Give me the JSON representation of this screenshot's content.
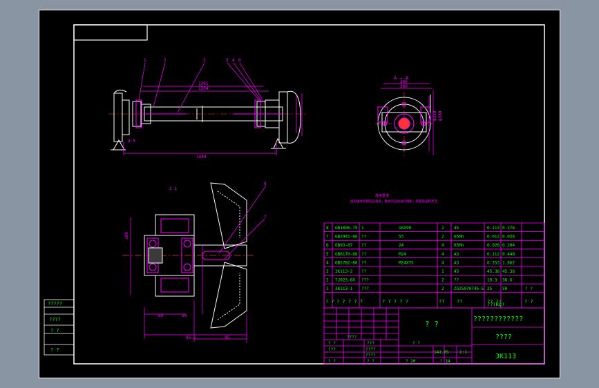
{
  "colors": {
    "frame": "#ffffff",
    "outline": "#ffffff",
    "dim": "#ff00ff",
    "leader": "#ff00ff",
    "text": "#00ff00",
    "section": "#ff00ff",
    "axis": "#ff3333",
    "table_line": "#ff00ff",
    "table_text": "#00ff00"
  },
  "top_view": {
    "balloons": [
      "1",
      "2",
      "3",
      "5",
      "4",
      "6"
    ],
    "dims": {
      "overall": "1440",
      "inner1": "1391",
      "inner2": "1304",
      "left_small": "4.5"
    }
  },
  "section_view": {
    "title": "A — A",
    "dims": {
      "top1": "340",
      "top2": "280",
      "right1": "φ350",
      "right2": "φ380"
    }
  },
  "detail_view": {
    "balloons": [
      "8",
      "7"
    ],
    "top_marks": "3   1",
    "dims": {
      "left": "100",
      "b1": "60",
      "b2": "50",
      "b3": "85.5",
      "b4": "95"
    }
  },
  "note_title": "技术要求",
  "note_text": "齿轮轴承装配前应清洗，轴承内应加注润滑脂，装配后运转灵活",
  "parts": [
    {
      "no": "8",
      "code": "GB1096-79",
      "name": "1",
      "spec": "16X90",
      "qty": "2",
      "mat": "45",
      "w1": "0.113",
      "w2": "0.276",
      "remark": ""
    },
    {
      "no": "7",
      "code": "GB2941-86",
      "name": "??",
      "spec": "55",
      "qty": "2",
      "mat": "65Mn",
      "w1": "0.012",
      "w2": "0.026",
      "remark": ""
    },
    {
      "no": "6",
      "code": "GB93-87",
      "name": "??",
      "spec": "24",
      "qty": "4",
      "mat": "65Mn",
      "w1": "0.026",
      "w2": "0.104",
      "remark": ""
    },
    {
      "no": "5",
      "code": "GB6170-86",
      "name": "??",
      "spec": "M24",
      "qty": "4",
      "mat": "A3",
      "w1": "0.112",
      "w2": "0.448",
      "remark": ""
    },
    {
      "no": "4",
      "code": "GB5782-86",
      "name": "??",
      "spec": "M24X75",
      "qty": "4",
      "mat": "A3",
      "w1": "0.353",
      "w2": "1.862",
      "remark": ""
    },
    {
      "no": "3",
      "code": "3K113-2",
      "name": "??",
      "spec": "",
      "qty": "1",
      "mat": "45",
      "w1": "45.36",
      "w2": "45.36",
      "remark": ""
    },
    {
      "no": "2",
      "code": "TJ023.60",
      "name": "???",
      "spec": "",
      "qty": "2",
      "mat": "??",
      "w1": "19.3",
      "w2": "38.6",
      "remark": ""
    },
    {
      "no": "1",
      "code": "3K113-1",
      "name": "???",
      "spec": "",
      "qty": "2",
      "mat": "ZG25070745-5",
      "w1": "25",
      "w2": "50",
      "remark": "? ?"
    }
  ],
  "parts_header": {
    "no": "?\n?",
    "code": "? ? ? ? ?",
    "name": "? ? ? ? ?",
    "qty": "??",
    "mat": "??",
    "weight": "??  ??",
    "weight_unit": "??(Kg)",
    "remark": "? ?"
  },
  "title_block": {
    "drawing_name": "? ?",
    "company": "????????????",
    "material": "????",
    "drawing_no": "3K113",
    "scale": "1:1",
    "ratio": "141.05",
    "sheet": "? 20",
    "sheets": "? 14",
    "labels": [
      "? ?",
      "????",
      "???",
      "?  ?",
      "???",
      "????",
      "????",
      "? ?",
      "? ?"
    ]
  },
  "side_stamps": [
    "?????",
    "????",
    "?  ?",
    "?  ?"
  ]
}
